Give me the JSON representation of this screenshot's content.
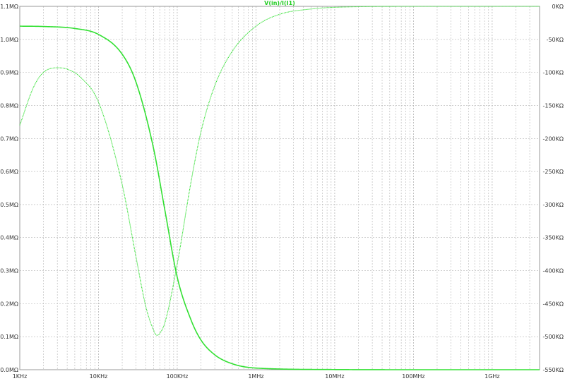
{
  "colors": {
    "background": "#ffffff",
    "frame": "#999999",
    "grid": "#b4b4b4",
    "tick_text": "#333333",
    "trace": "#33e033",
    "title": "#22cc22"
  },
  "chart_data": {
    "type": "line",
    "title": "V(in)/I(I1)",
    "x_scale": "log",
    "grid": true,
    "xlim": [
      1000,
      4000000000
    ],
    "x_ticks": [
      {
        "value": 1000,
        "label": "1KHz"
      },
      {
        "value": 10000,
        "label": "10KHz"
      },
      {
        "value": 100000,
        "label": "100KHz"
      },
      {
        "value": 1000000,
        "label": "1MHz"
      },
      {
        "value": 10000000,
        "label": "10MHz"
      },
      {
        "value": 100000000,
        "label": "100MHz"
      },
      {
        "value": 1000000000,
        "label": "1GHz"
      }
    ],
    "left_axis": {
      "unit": "MΩ",
      "ylim": [
        0,
        1.1
      ],
      "ticks": [
        {
          "value": 0.0,
          "label": "0.0MΩ"
        },
        {
          "value": 0.1,
          "label": "0.1MΩ"
        },
        {
          "value": 0.2,
          "label": "0.2MΩ"
        },
        {
          "value": 0.3,
          "label": "0.3MΩ"
        },
        {
          "value": 0.4,
          "label": "0.4MΩ"
        },
        {
          "value": 0.5,
          "label": "0.5MΩ"
        },
        {
          "value": 0.6,
          "label": "0.6MΩ"
        },
        {
          "value": 0.7,
          "label": "0.7MΩ"
        },
        {
          "value": 0.8,
          "label": "0.8MΩ"
        },
        {
          "value": 0.9,
          "label": "0.9MΩ"
        },
        {
          "value": 1.0,
          "label": "1.0MΩ"
        },
        {
          "value": 1.1,
          "label": "1.1MΩ"
        }
      ]
    },
    "right_axis": {
      "unit": "KΩ",
      "ylim": [
        -550,
        0
      ],
      "ticks": [
        {
          "value": 0,
          "label": "0KΩ"
        },
        {
          "value": -50,
          "label": "-50KΩ"
        },
        {
          "value": -100,
          "label": "-100KΩ"
        },
        {
          "value": -150,
          "label": "-150KΩ"
        },
        {
          "value": -200,
          "label": "-200KΩ"
        },
        {
          "value": -250,
          "label": "-250KΩ"
        },
        {
          "value": -300,
          "label": "-300KΩ"
        },
        {
          "value": -350,
          "label": "-350KΩ"
        },
        {
          "value": -400,
          "label": "-400KΩ"
        },
        {
          "value": -450,
          "label": "-450KΩ"
        },
        {
          "value": -500,
          "label": "-500KΩ"
        },
        {
          "value": -550,
          "label": "-550KΩ"
        }
      ]
    },
    "series": [
      {
        "style": "solid",
        "axis": "left",
        "x": [
          1000,
          2000,
          5000,
          10000,
          20000,
          30000,
          50000,
          70000,
          100000,
          150000,
          200000,
          300000,
          500000,
          1000000,
          10000000,
          100000000,
          1000000000,
          4000000000
        ],
        "values": [
          1.04,
          1.039,
          1.033,
          1.015,
          0.955,
          0.87,
          0.67,
          0.48,
          0.28,
          0.15,
          0.09,
          0.045,
          0.018,
          0.005,
          0.0005,
          0.0,
          0.0,
          0.0
        ]
      },
      {
        "style": "dotted",
        "axis": "right",
        "x": [
          1000,
          1500,
          2000,
          3000,
          4000,
          6000,
          10000,
          20000,
          30000,
          40000,
          50000,
          55000,
          60000,
          70000,
          100000,
          150000,
          200000,
          300000,
          500000,
          1000000,
          2000000,
          5000000,
          10000000,
          100000000,
          1000000000,
          4000000000
        ],
        "values": [
          -180,
          -122,
          -100,
          -93,
          -95,
          -108,
          -145,
          -270,
          -380,
          -455,
          -490,
          -498,
          -495,
          -478,
          -390,
          -265,
          -190,
          -120,
          -68,
          -30,
          -12,
          -4,
          -1.5,
          0,
          0,
          0
        ]
      }
    ]
  }
}
